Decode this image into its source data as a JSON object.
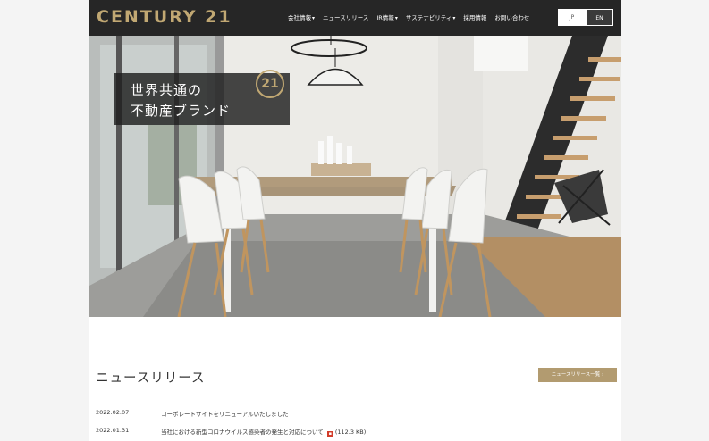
{
  "header": {
    "logo": "CENTURY 21",
    "nav": [
      {
        "label": "会社情報",
        "dropdown": true
      },
      {
        "label": "ニュースリリース",
        "dropdown": false
      },
      {
        "label": "IR情報",
        "dropdown": true
      },
      {
        "label": "サステナビリティ",
        "dropdown": true
      },
      {
        "label": "採用情報",
        "dropdown": false
      },
      {
        "label": "お問い合わせ",
        "dropdown": false
      }
    ],
    "lang": {
      "jp": "JP",
      "en": "EN"
    }
  },
  "hero": {
    "tagline_line1": "世界共通の",
    "tagline_line2": "不動産ブランド",
    "badge": "21"
  },
  "news": {
    "title": "ニュースリリース",
    "more_button": "ニュースリリース一覧 ›",
    "items": [
      {
        "date": "2022.02.07",
        "text": "コーポレートサイトをリニューアルいたしました",
        "attachment": ""
      },
      {
        "date": "2022.01.31",
        "text": "当社における新型コロナウイルス感染者の発生と対応について",
        "attachment": "(112.3 KB)"
      }
    ]
  },
  "colors": {
    "brand_gold": "#c1a873",
    "header_bg": "#262626",
    "button_bg": "#b29b70",
    "pdf_red": "#d23c2a"
  },
  "icons": {
    "caret": "chevron-down-icon",
    "pdf": "pdf-icon"
  }
}
